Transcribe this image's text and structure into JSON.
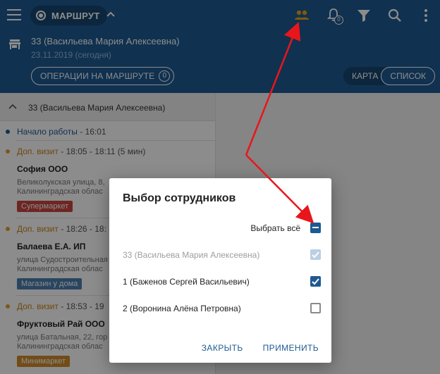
{
  "header": {
    "route_label": "МАРШРУТ",
    "notifications_count": "0",
    "employee": "33 (Васильева Мария Алексеевна)",
    "date": "23.11.2019 (сегодня)",
    "ops_label": "ОПЕРАЦИИ НА МАРШРУТЕ",
    "ops_count": "0",
    "map_label": "КАРТА",
    "list_label": "СПИСОК"
  },
  "colors": {
    "primary": "#1e5a92",
    "visit_dot": "#e0a030",
    "start_dot": "#1e5a92",
    "annotation": "#e8161b"
  },
  "list": {
    "group_title": "33 (Васильева Мария Алексеевна)",
    "start": {
      "label": "Начало работы",
      "time": "- 16:01"
    },
    "visits": [
      {
        "type": "Доп. визит",
        "time": "- 18:05 - 18:11 (5 мин)",
        "title": "София ООО",
        "addr1": "Великолукская улица, 8,",
        "addr2": "Калининградская облас",
        "tag": "Супермаркет",
        "tag_color": "#c9453f"
      },
      {
        "type": "Доп. визит",
        "time": "- 18:26 - 18:",
        "title": "Балаева Е.А. ИП",
        "addr1": "улица Судостроительная",
        "addr2": "Калининградская облас",
        "tag": "Магазин у дома",
        "tag_color": "#4b7fb0"
      },
      {
        "type": "Доп. визит",
        "time": "- 18:53 - 19",
        "title": "Фруктовый Рай ООО",
        "addr1": "улица Батальная, 22, гор",
        "addr2": "Калининградская облас",
        "tag": "Минимаркет",
        "tag_color": "#d08a2a"
      }
    ]
  },
  "dialog": {
    "title": "Выбор сотрудников",
    "select_all": "Выбрать всё",
    "employees": [
      {
        "name": "33 (Васильева Мария Алексеевна)",
        "state": "checked-disabled"
      },
      {
        "name": "1 (Баженов Сергей Васильевич)",
        "state": "checked"
      },
      {
        "name": "2 (Воронина Алёна Петровна)",
        "state": "unchecked"
      }
    ],
    "close_label": "ЗАКРЫТЬ",
    "apply_label": "ПРИМЕНИТЬ"
  }
}
